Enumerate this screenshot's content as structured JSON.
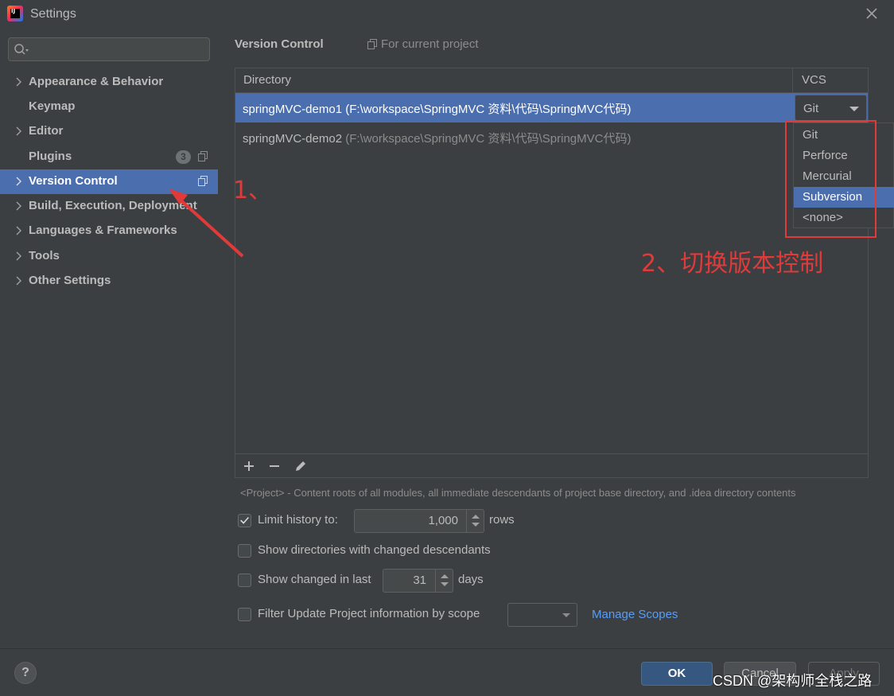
{
  "window": {
    "title": "Settings",
    "icon_text": "IJ"
  },
  "sidebar": {
    "search": {
      "placeholder": "",
      "value": ""
    },
    "items": [
      {
        "label": "Appearance & Behavior",
        "expandable": true
      },
      {
        "label": "Keymap",
        "expandable": false
      },
      {
        "label": "Editor",
        "expandable": true
      },
      {
        "label": "Plugins",
        "expandable": false,
        "badge": "3"
      },
      {
        "label": "Version Control",
        "expandable": true,
        "selected": true
      },
      {
        "label": "Build, Execution, Deployment",
        "expandable": true
      },
      {
        "label": "Languages & Frameworks",
        "expandable": true
      },
      {
        "label": "Tools",
        "expandable": true
      },
      {
        "label": "Other Settings",
        "expandable": true
      }
    ]
  },
  "main": {
    "title": "Version Control",
    "scope": "For current project",
    "table": {
      "columns": [
        "Directory",
        "VCS"
      ],
      "rows": [
        {
          "name": "springMVC-demo1",
          "path": "(F:\\workspace\\SpringMVC 资料\\代码\\SpringMVC代码)",
          "vcs": "Git",
          "selected": true
        },
        {
          "name": "springMVC-demo2",
          "path": "(F:\\workspace\\SpringMVC 资料\\代码\\SpringMVC代码)",
          "vcs": "",
          "selected": false
        }
      ]
    },
    "vcs_dropdown": {
      "options": [
        "Git",
        "Perforce",
        "Mercurial",
        "Subversion",
        "<none>"
      ],
      "highlighted": "Subversion"
    },
    "hint": "<Project> - Content roots of all modules, all immediate descendants of project base directory, and .idea directory contents",
    "options": {
      "limit_history": {
        "label": "Limit history to:",
        "checked": true,
        "value": "1,000",
        "suffix": "rows"
      },
      "show_dirs": {
        "label": "Show directories with changed descendants",
        "checked": false
      },
      "show_changed": {
        "label": "Show changed in last",
        "checked": false,
        "value": "31",
        "suffix": "days"
      },
      "filter_update": {
        "label": "Filter Update Project information by scope",
        "checked": false,
        "link": "Manage Scopes"
      }
    }
  },
  "footer": {
    "help": "?",
    "ok": "OK",
    "cancel": "Cancel",
    "apply": "Apply"
  },
  "annotations": {
    "step1": "1、",
    "step2": "2、切换版本控制",
    "watermark": "CSDN @架构师全栈之路"
  },
  "colors": {
    "background": "#3c3f41",
    "selection": "#4b6eaf",
    "annotation_red": "#e03a3a",
    "link": "#589df6"
  }
}
